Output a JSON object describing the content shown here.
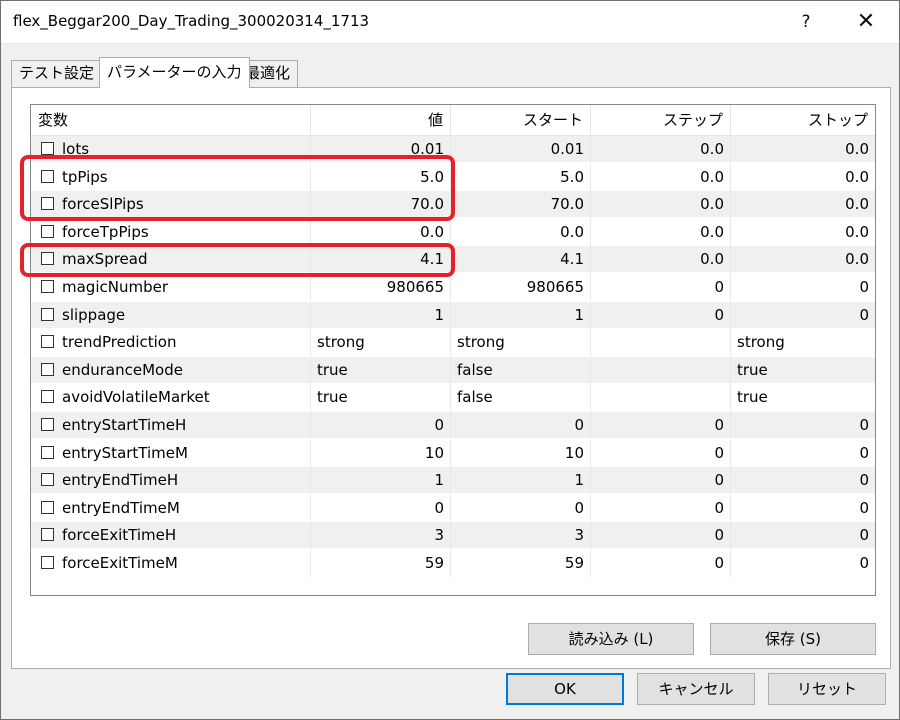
{
  "window": {
    "title": "flex_Beggar200_Day_Trading_300020314_1713",
    "help_label": "?",
    "close_label": "✕"
  },
  "tabs": [
    {
      "label": "テスト設定"
    },
    {
      "label": "パラメーターの入力"
    },
    {
      "label": "最適化"
    }
  ],
  "table": {
    "headers": [
      "変数",
      "値",
      "スタート",
      "ステップ",
      "ストップ"
    ],
    "rows": [
      {
        "name": "lots",
        "value": "0.01",
        "start": "0.01",
        "step": "0.0",
        "stop": "0.0"
      },
      {
        "name": "tpPips",
        "value": "5.0",
        "start": "5.0",
        "step": "0.0",
        "stop": "0.0"
      },
      {
        "name": "forceSlPips",
        "value": "70.0",
        "start": "70.0",
        "step": "0.0",
        "stop": "0.0"
      },
      {
        "name": "forceTpPips",
        "value": "0.0",
        "start": "0.0",
        "step": "0.0",
        "stop": "0.0"
      },
      {
        "name": "maxSpread",
        "value": "4.1",
        "start": "4.1",
        "step": "0.0",
        "stop": "0.0"
      },
      {
        "name": "magicNumber",
        "value": "980665",
        "start": "980665",
        "step": "0",
        "stop": "0"
      },
      {
        "name": "slippage",
        "value": "1",
        "start": "1",
        "step": "0",
        "stop": "0"
      },
      {
        "name": "trendPrediction",
        "value": "strong",
        "start": "strong",
        "step": "",
        "stop": "strong"
      },
      {
        "name": "enduranceMode",
        "value": "true",
        "start": "false",
        "step": "",
        "stop": "true"
      },
      {
        "name": "avoidVolatileMarket",
        "value": "true",
        "start": "false",
        "step": "",
        "stop": "true"
      },
      {
        "name": "entryStartTimeH",
        "value": "0",
        "start": "0",
        "step": "0",
        "stop": "0"
      },
      {
        "name": "entryStartTimeM",
        "value": "10",
        "start": "10",
        "step": "0",
        "stop": "0"
      },
      {
        "name": "entryEndTimeH",
        "value": "1",
        "start": "1",
        "step": "0",
        "stop": "0"
      },
      {
        "name": "entryEndTimeM",
        "value": "0",
        "start": "0",
        "step": "0",
        "stop": "0"
      },
      {
        "name": "forceExitTimeH",
        "value": "3",
        "start": "3",
        "step": "0",
        "stop": "0"
      },
      {
        "name": "forceExitTimeM",
        "value": "59",
        "start": "59",
        "step": "0",
        "stop": "0"
      }
    ]
  },
  "panel_buttons": {
    "load_label": "読み込み (L)",
    "save_label": "保存 (S)"
  },
  "dialog_buttons": {
    "ok_label": "OK",
    "cancel_label": "キャンセル",
    "reset_label": "リセット"
  },
  "colors": {
    "highlight": "#e8202a",
    "default_button_border": "#0078d7"
  }
}
